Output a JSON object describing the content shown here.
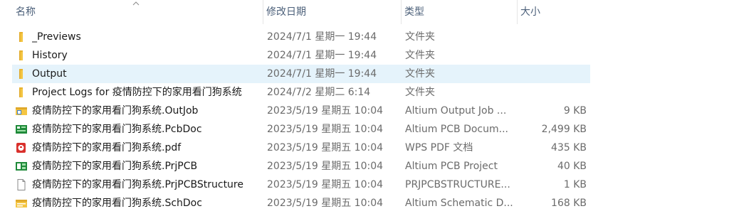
{
  "header": {
    "name_label": "名称",
    "date_label": "修改日期",
    "type_label": "类型",
    "size_label": "大小"
  },
  "rows": [
    {
      "name": "_Previews",
      "date": "2024/7/1 星期一 19:44",
      "type": "文件夹",
      "size": "",
      "icon": "folder-icon"
    },
    {
      "name": "History",
      "date": "2024/7/1 星期一 19:44",
      "type": "文件夹",
      "size": "",
      "icon": "folder-icon"
    },
    {
      "name": "Output",
      "date": "2024/7/1 星期一 19:44",
      "type": "文件夹",
      "size": "",
      "icon": "folder-icon",
      "selected": true
    },
    {
      "name": "Project Logs for 疫情防控下的家用看门狗系统",
      "date": "2024/7/2 星期二 6:14",
      "type": "文件夹",
      "size": "",
      "icon": "folder-icon"
    },
    {
      "name": "疫情防控下的家用看门狗系统.OutJob",
      "date": "2023/5/19 星期五 10:04",
      "type": "Altium Output Job ...",
      "size": "9 KB",
      "icon": "outjob-file-icon"
    },
    {
      "name": "疫情防控下的家用看门狗系统.PcbDoc",
      "date": "2023/5/19 星期五 10:04",
      "type": "Altium PCB Docum...",
      "size": "2,499 KB",
      "icon": "pcbdoc-file-icon"
    },
    {
      "name": "疫情防控下的家用看门狗系统.pdf",
      "date": "2023/5/19 星期五 10:04",
      "type": "WPS PDF 文档",
      "size": "435 KB",
      "icon": "pdf-file-icon"
    },
    {
      "name": "疫情防控下的家用看门狗系统.PrjPCB",
      "date": "2023/5/19 星期五 10:04",
      "type": "Altium PCB Project",
      "size": "40 KB",
      "icon": "prjpcb-file-icon"
    },
    {
      "name": "疫情防控下的家用看门狗系统.PrjPCBStructure",
      "date": "2023/5/19 星期五 10:04",
      "type": "PRJPCBSTRUCTURE...",
      "size": "1 KB",
      "icon": "generic-file-icon"
    },
    {
      "name": "疫情防控下的家用看门狗系统.SchDoc",
      "date": "2023/5/19 星期五 10:04",
      "type": "Altium Schematic D...",
      "size": "168 KB",
      "icon": "schdoc-file-icon"
    }
  ],
  "colors": {
    "header_text": "#4c607a",
    "selected_row": "#e5f3fb",
    "folder": "#f4c542",
    "pcb_green": "#1f8a3a",
    "pdf_red": "#d9302c"
  }
}
